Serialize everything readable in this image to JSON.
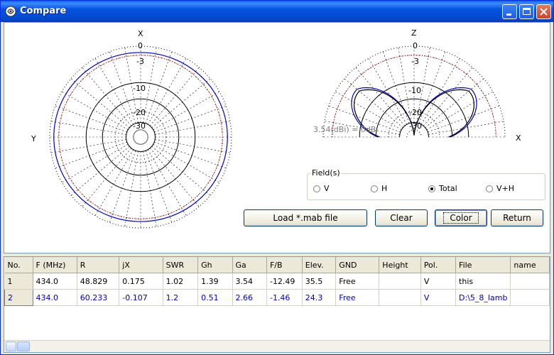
{
  "window": {
    "title": "Compare"
  },
  "left_plot": {
    "label_top": "X",
    "label_left": "Y",
    "rings": [
      "0",
      "-3",
      "-10",
      "-20",
      "-30"
    ]
  },
  "right_plot": {
    "label_top": "Z",
    "label_right": "X",
    "rings": [
      "0",
      "-3",
      "-10",
      "-20",
      "-30"
    ],
    "caption": "3.54(dBi) = 0dB"
  },
  "fields": {
    "legend": "Field(s)",
    "options": [
      {
        "label": "V",
        "selected": false
      },
      {
        "label": "H",
        "selected": false
      },
      {
        "label": "Total",
        "selected": true
      },
      {
        "label": "V+H",
        "selected": false
      }
    ]
  },
  "buttons": {
    "load": "Load *.mab file",
    "clear": "Clear",
    "color": "Color",
    "return": "Return"
  },
  "table": {
    "columns": [
      "No.",
      "F (MHz)",
      "R",
      "jX",
      "SWR",
      "Gh",
      "Ga",
      "F/B",
      "Elev.",
      "GND",
      "Height",
      "Pol.",
      "File",
      "name"
    ],
    "rows": [
      [
        "1",
        "434.0",
        "48.829",
        "0.175",
        "1.02",
        "1.39",
        "3.54",
        "-12.49",
        "35.5",
        "Free",
        "",
        "V",
        "this",
        ""
      ],
      [
        "2",
        "434.0",
        "60.233",
        "-0.107",
        "1.2",
        "0.51",
        "2.66",
        "-1.46",
        "24.3",
        "Free",
        "",
        "V",
        "D:\\5_8_lamb",
        ""
      ]
    ]
  },
  "colors": {
    "series1": "#000000",
    "series2": "#0000c0",
    "reference": "#cc0000"
  }
}
